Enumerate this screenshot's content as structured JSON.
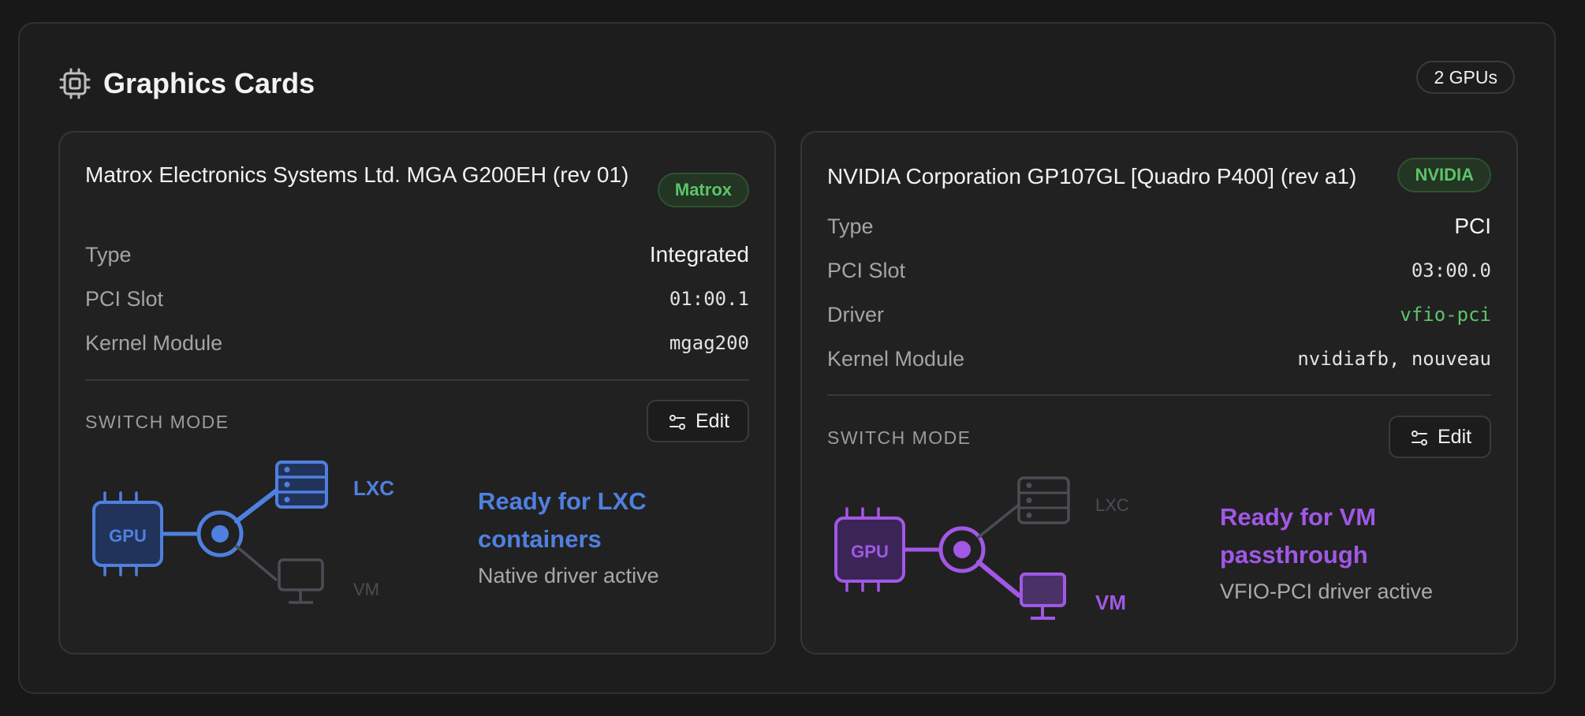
{
  "panel": {
    "title": "Graphics Cards",
    "title_icon": "chip-icon",
    "count_badge": "2 GPUs"
  },
  "cards": [
    {
      "name": "Matrox Electronics Systems Ltd. MGA G200EH (rev 01)",
      "vendor": "Matrox",
      "rows": [
        {
          "label": "Type",
          "value": "Integrated"
        },
        {
          "label": "PCI Slot",
          "value": "01:00.1"
        },
        {
          "label": "Kernel Module",
          "value": "mgag200"
        }
      ],
      "switch_label": "SWITCH MODE",
      "edit_label": "Edit",
      "diagram": {
        "gpu_label": "GPU",
        "lxc_label": "LXC",
        "vm_label": "VM",
        "active": "LXC"
      },
      "status_title": "Ready for LXC containers",
      "status_sub": "Native driver active",
      "accent": "#4f80e0"
    },
    {
      "name": "NVIDIA Corporation GP107GL [Quadro P400] (rev a1)",
      "vendor": "NVIDIA",
      "rows": [
        {
          "label": "Type",
          "value": "PCI"
        },
        {
          "label": "PCI Slot",
          "value": "03:00.0"
        },
        {
          "label": "Driver",
          "value": "vfio-pci"
        },
        {
          "label": "Kernel Module",
          "value": "nvidiafb, nouveau"
        }
      ],
      "switch_label": "SWITCH MODE",
      "edit_label": "Edit",
      "diagram": {
        "gpu_label": "GPU",
        "lxc_label": "LXC",
        "vm_label": "VM",
        "active": "VM"
      },
      "status_title": "Ready for VM passthrough",
      "status_sub": "VFIO-PCI driver active",
      "accent": "#a158e6"
    }
  ],
  "colors": {
    "vendor_badge_text": "#5cc46a",
    "inactive": "#4a4d54"
  }
}
